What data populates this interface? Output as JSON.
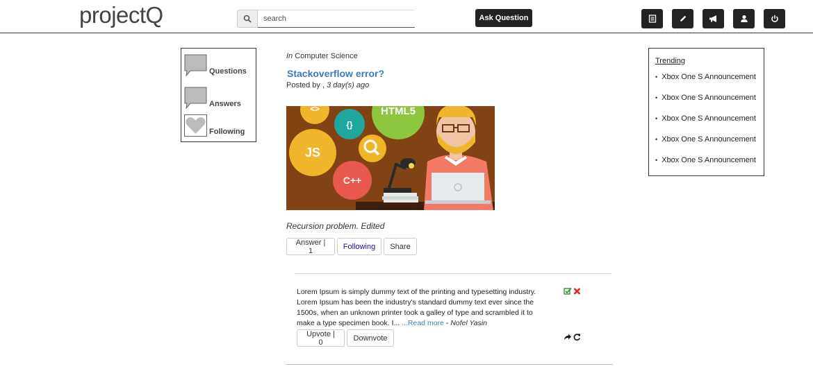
{
  "header": {
    "logo": "projectQ",
    "search_placeholder": "search",
    "ask_label": "Ask Question",
    "nav_icons": [
      "list-icon",
      "pencil-icon",
      "megaphone-icon",
      "user-icon",
      "power-icon"
    ]
  },
  "sidebar": {
    "items": [
      {
        "label": "Questions",
        "icon": "speech-bubble-icon"
      },
      {
        "label": "Answers",
        "icon": "speech-bubble-icon"
      },
      {
        "label": "Following",
        "icon": "heart-icon"
      }
    ]
  },
  "question": {
    "category_prefix": "In",
    "category": "Computer Science",
    "title": "Stackoverflow error?",
    "posted_prefix": "Posted by ,",
    "posted_time": "3 day(s) ago",
    "image_labels": [
      "<>",
      "HTML5",
      "{}",
      "JS",
      "C++"
    ],
    "description": "Recursion problem. Edited",
    "buttons": {
      "answer": "Answer | 1",
      "following": "Following",
      "share": "Share"
    }
  },
  "answer": {
    "text": "Lorem Ipsum is simply dummy text of the printing and typesetting industry. Lorem Ipsum has been the industry's standard dummy text ever since the 1500s, when an unknown printer took a galley of type and scrambled it to make a type specimen book. I...",
    "read_more": "...Read more",
    "separator": " - ",
    "author": "Nofel Yasin",
    "buttons": {
      "upvote": "Upvote | 0",
      "downvote": "Downvote"
    }
  },
  "trending": {
    "title": "Trending",
    "items": [
      "Xbox One S Announcement",
      "Xbox One S Announcement",
      "Xbox One S Announcement",
      "Xbox One S Announcement",
      "Xbox One S Announcement"
    ]
  },
  "colors": {
    "link": "#3a7cb8",
    "dark_button": "#222222",
    "following": "#1a0dab",
    "edit_icon": "#2e9a2e",
    "delete_icon": "#e02020"
  }
}
